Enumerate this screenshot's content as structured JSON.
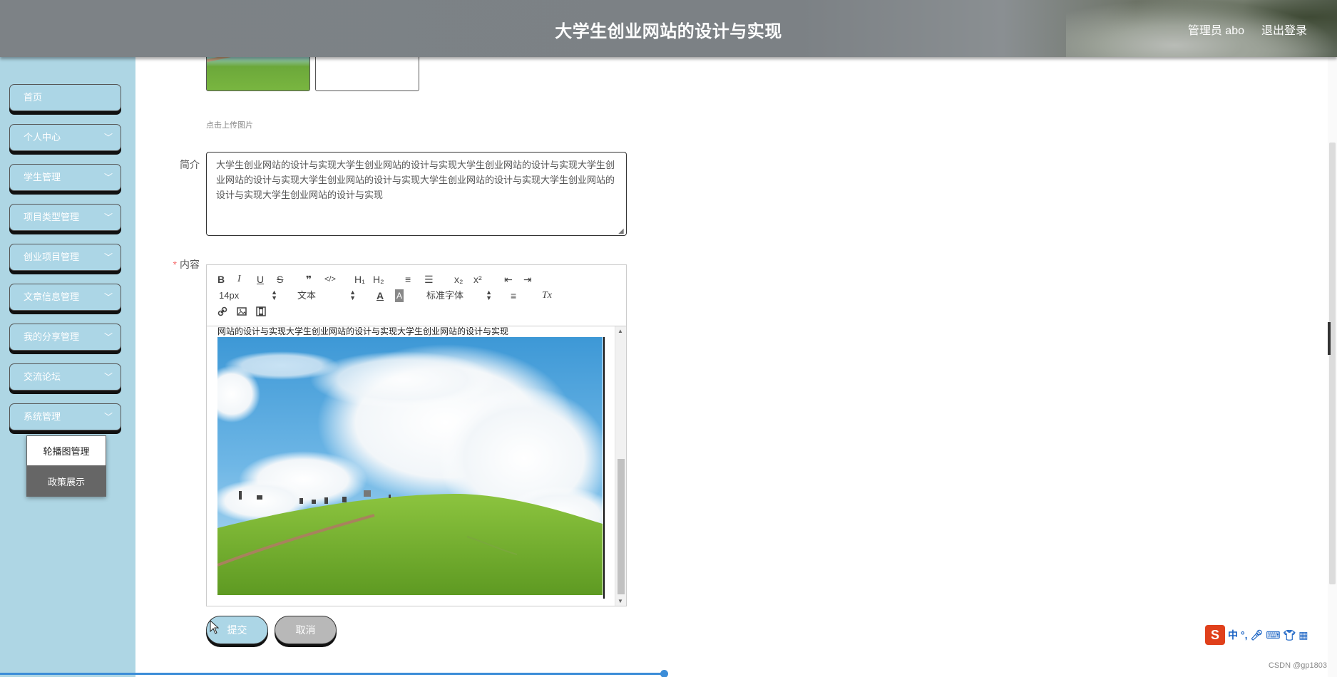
{
  "header": {
    "title": "大学生创业网站的设计与实现",
    "user": "管理员 abo",
    "logout": "退出登录"
  },
  "sidebar": {
    "items": [
      {
        "label": "首页",
        "has_chevron": false
      },
      {
        "label": "个人中心",
        "has_chevron": true
      },
      {
        "label": "学生管理",
        "has_chevron": true
      },
      {
        "label": "项目类型管理",
        "has_chevron": true
      },
      {
        "label": "创业项目管理",
        "has_chevron": true
      },
      {
        "label": "文章信息管理",
        "has_chevron": true
      },
      {
        "label": "我的分享管理",
        "has_chevron": true
      },
      {
        "label": "交流论坛",
        "has_chevron": true
      },
      {
        "label": "系统管理",
        "has_chevron": true
      }
    ],
    "submenu": [
      {
        "label": "轮播图管理",
        "active": false
      },
      {
        "label": "政策展示",
        "active": true
      }
    ]
  },
  "form": {
    "upload_hint": "点击上传图片",
    "intro_label": "简介",
    "intro_value": "大学生创业网站的设计与实现大学生创业网站的设计与实现大学生创业网站的设计与实现大学生创业网站的设计与实现大学生创业网站的设计与实现大学生创业网站的设计与实现大学生创业网站的设计与实现大学生创业网站的设计与实现",
    "content_label": "内容",
    "content_required": "*",
    "editor_text": "网站的设计与实现大学生创业网站的设计与实现大学生创业网站的设计与实现",
    "submit": "提交",
    "cancel": "取消"
  },
  "editor_toolbar": {
    "font_size": "14px",
    "format": "文本",
    "font_family": "标准字体",
    "buttons": {
      "bold": "B",
      "italic": "I",
      "underline": "U",
      "strike": "S",
      "quote": "❞",
      "code": "</>",
      "h1": "H₁",
      "h2": "H₂",
      "ordered": "≡",
      "bullet": "☰",
      "sub": "x₂",
      "sup": "x²",
      "outdent": "⇤",
      "indent": "⇥",
      "color": "A",
      "background": "A",
      "align": "≡",
      "clean": "Tx"
    }
  },
  "ime": {
    "logo": "S",
    "lang": "中",
    "punct": "°,"
  },
  "watermark": "CSDN @gp1803",
  "colors": {
    "sidebar_bg": "#aed6e4",
    "header_bg": "#7d8286",
    "accent_blue": "#3c8dd8",
    "required": "#f56c6c"
  }
}
